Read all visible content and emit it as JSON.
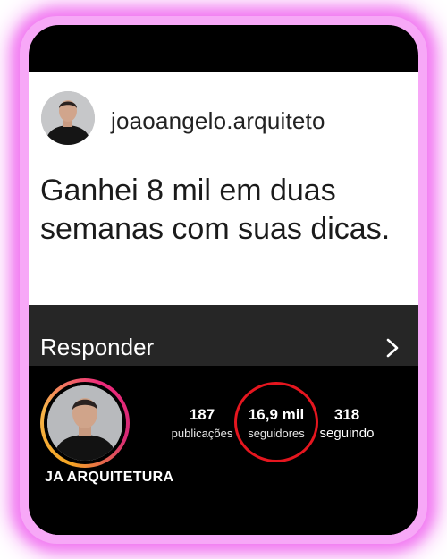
{
  "message_card": {
    "username": "joaoangelo.arquiteto",
    "message": "Ganhei 8 mil em duas semanas com suas dicas."
  },
  "reply_bar": {
    "label": "Responder",
    "icon": "chevron-right-icon"
  },
  "profile": {
    "name": "JA ARQUITETURA",
    "stats": [
      {
        "value": "187",
        "label": "publicações"
      },
      {
        "value": "16,9 mil",
        "label": "seguidores"
      },
      {
        "value": "318",
        "label": "seguindo"
      }
    ]
  },
  "colors": {
    "glow": "#f27cf2",
    "highlight_circle": "#e5161f",
    "story_ring_start": "#f5a623",
    "story_ring_end": "#d62976"
  }
}
